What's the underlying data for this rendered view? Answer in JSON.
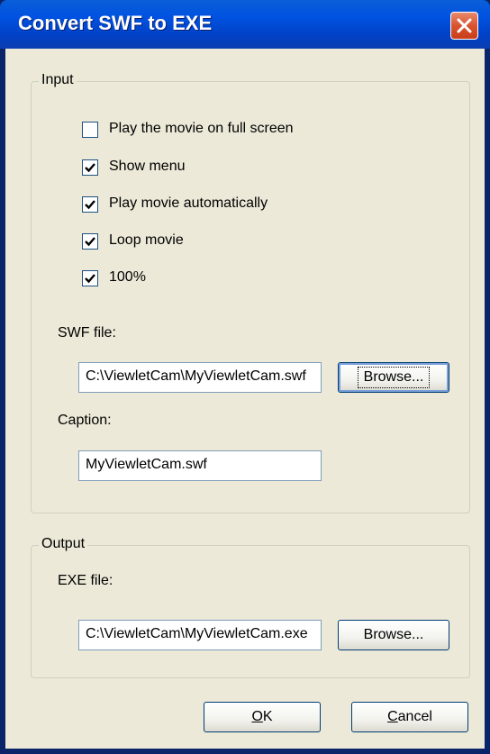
{
  "window": {
    "title": "Convert SWF to EXE"
  },
  "input_group": {
    "label": "Input",
    "options": [
      {
        "label": "Play the movie on full screen",
        "checked": false
      },
      {
        "label": "Show menu",
        "checked": true
      },
      {
        "label": "Play movie automatically",
        "checked": true
      },
      {
        "label": "Loop movie",
        "checked": true
      },
      {
        "label": "100%",
        "checked": true
      }
    ],
    "swf_label": "SWF file:",
    "swf_value": "C:\\ViewletCam\\MyViewletCam.swf",
    "browse_label": "Browse...",
    "caption_label": "Caption:",
    "caption_value": "MyViewletCam.swf"
  },
  "output_group": {
    "label": "Output",
    "exe_label": "EXE file:",
    "exe_value": "C:\\ViewletCam\\MyViewletCam.exe",
    "browse_label": "Browse..."
  },
  "buttons": {
    "ok_accel": "O",
    "ok_rest": "K",
    "cancel_accel": "C",
    "cancel_rest": "ancel"
  }
}
